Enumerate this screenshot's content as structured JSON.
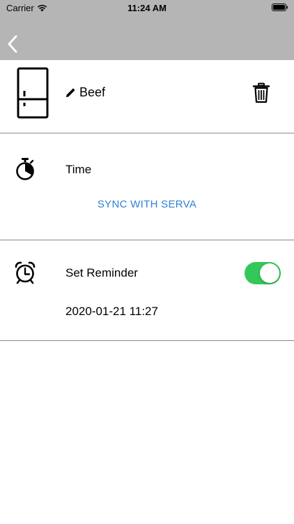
{
  "status_bar": {
    "carrier": "Carrier",
    "time": "11:24 AM",
    "wifi_icon": "wifi-icon",
    "battery_icon": "battery-icon"
  },
  "nav": {
    "back_icon": "chevron-left-icon"
  },
  "item": {
    "name": "Beef",
    "icon": "fridge-icon",
    "edit_icon": "pencil-icon",
    "delete_icon": "trash-icon"
  },
  "time_section": {
    "label": "Time",
    "icon": "stopwatch-icon",
    "sync_label": "SYNC WITH SERVA"
  },
  "reminder_section": {
    "label": "Set Reminder",
    "icon": "alarm-clock-icon",
    "enabled": true,
    "datetime": "2020-01-21 11:27"
  },
  "colors": {
    "nav_background": "#b5b5b5",
    "link": "#2f80d8",
    "toggle_on": "#34c759",
    "divider": "#8a8a8a"
  }
}
